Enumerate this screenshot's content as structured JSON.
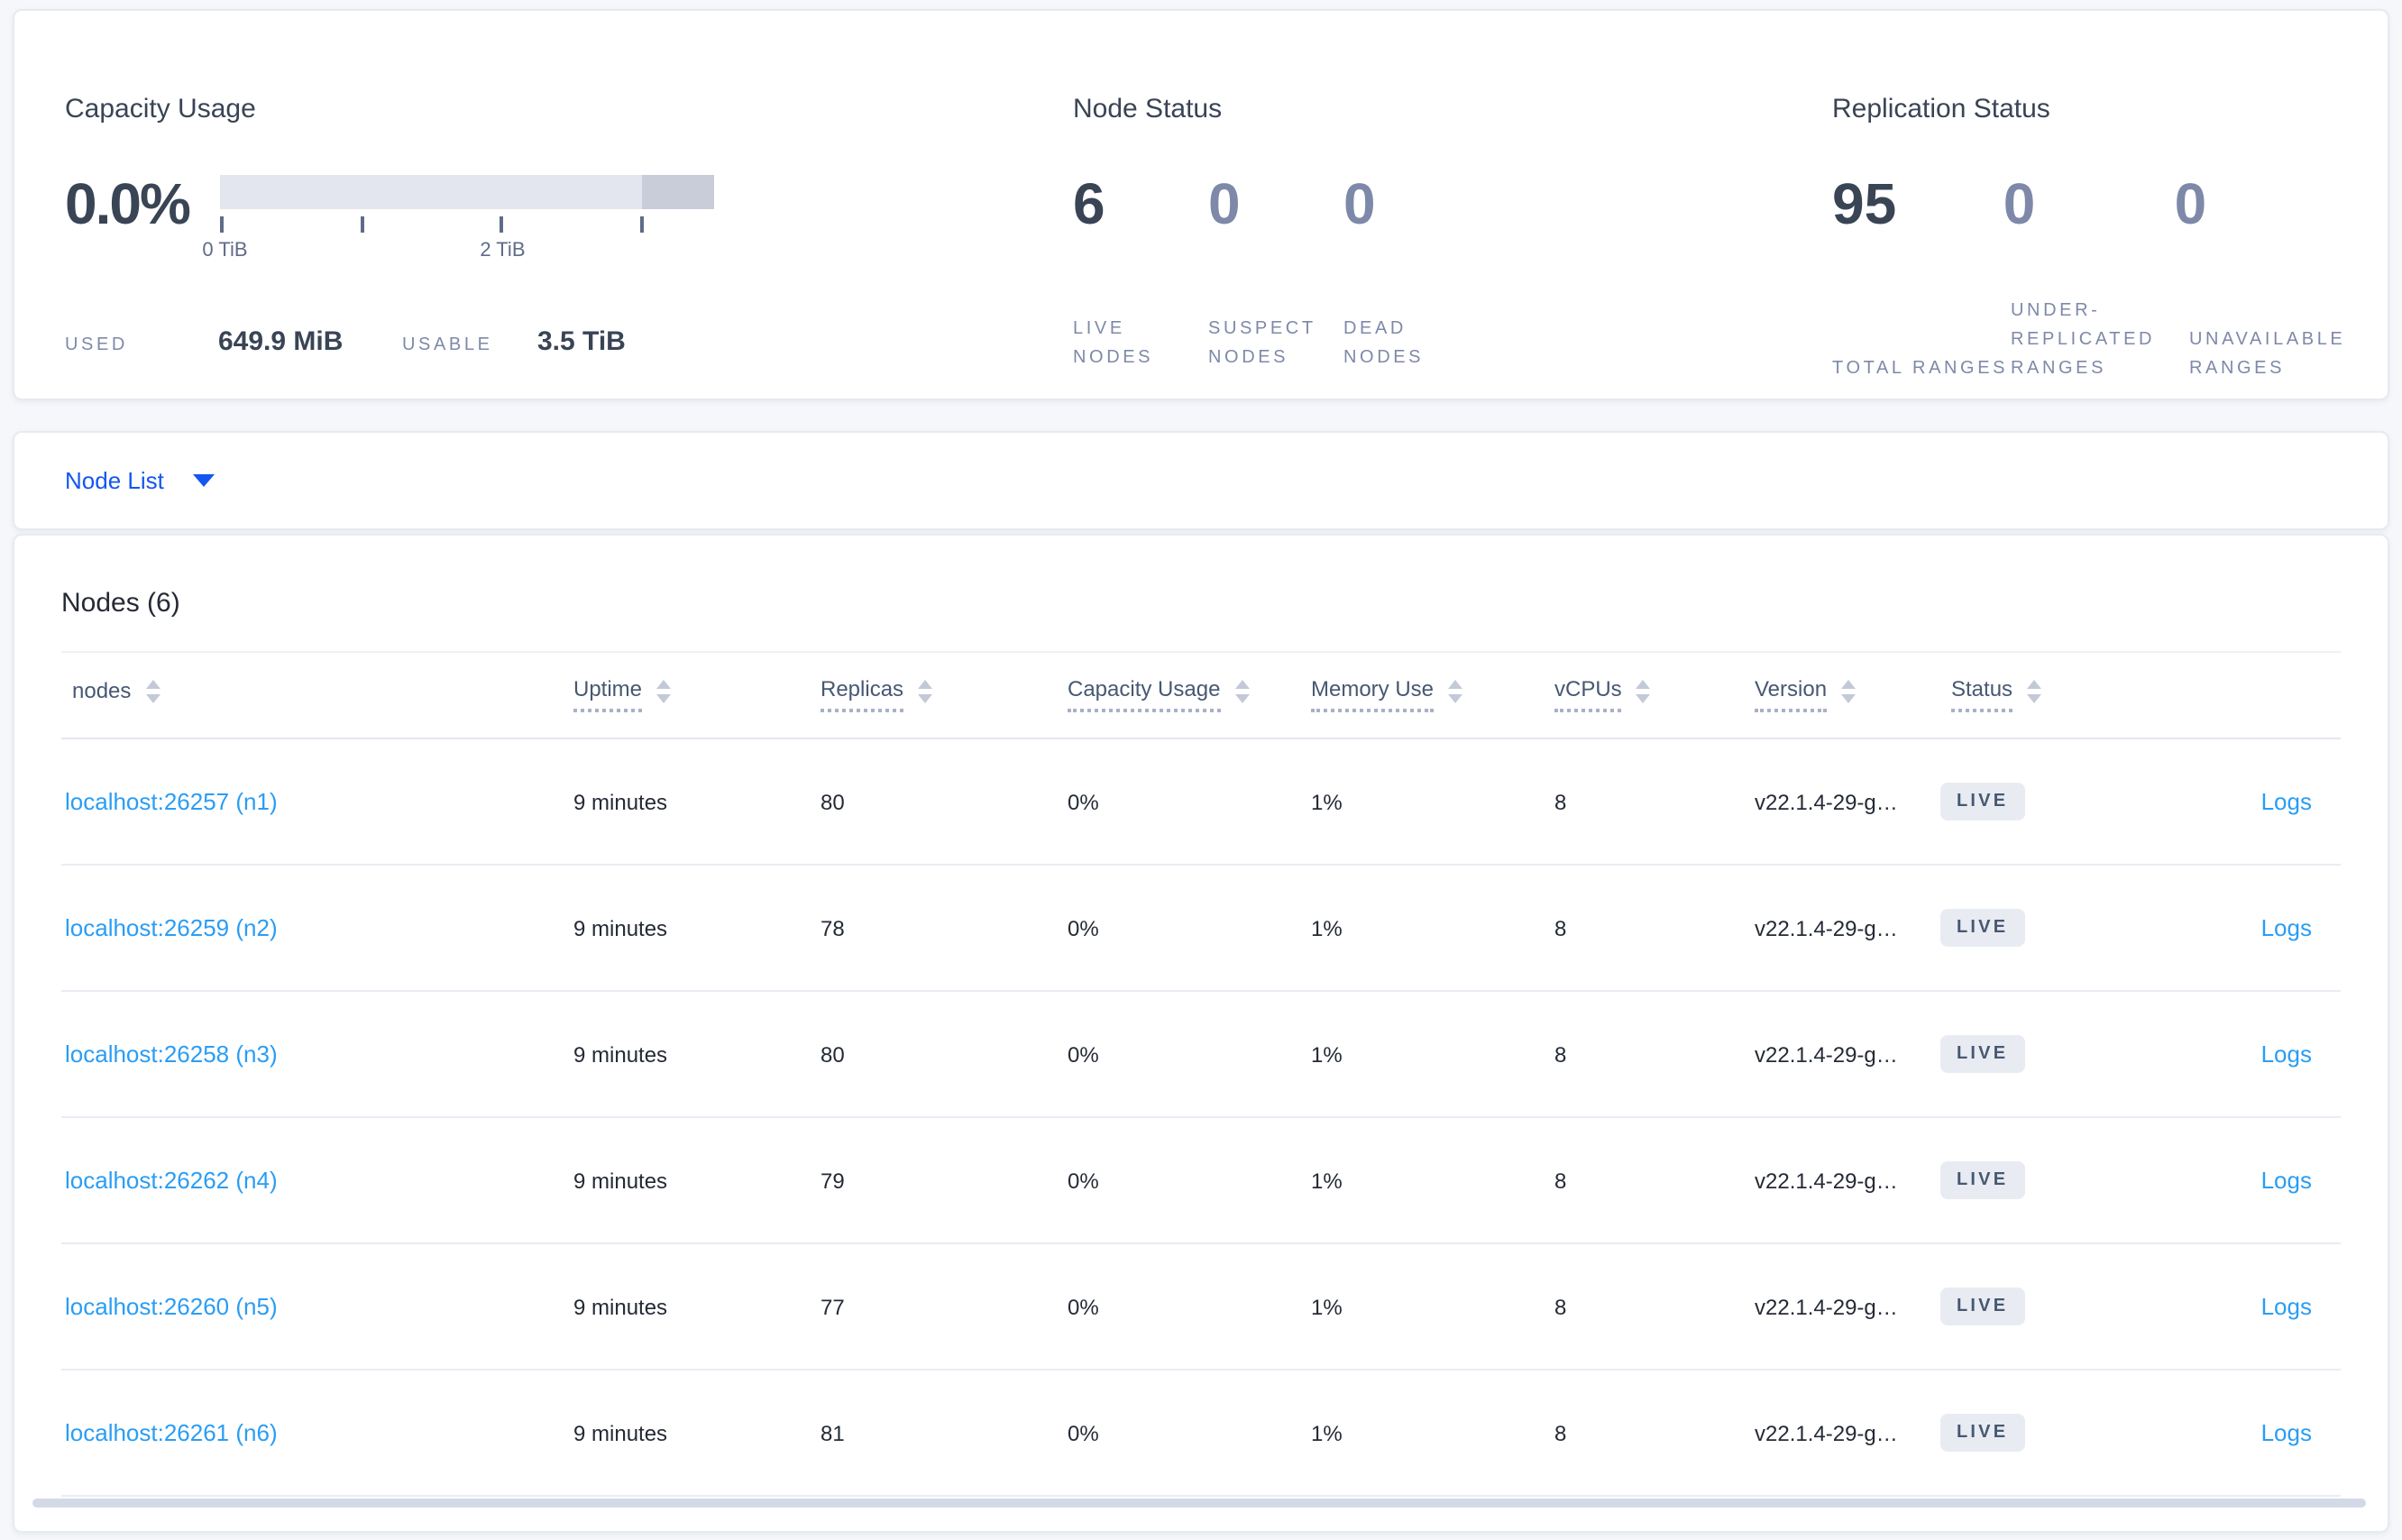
{
  "summary": {
    "capacity": {
      "title": "Capacity Usage",
      "percent": "0.0%",
      "tick_labels": [
        "0 TiB",
        "2 TiB"
      ],
      "stats": [
        {
          "label": "USED",
          "value": "649.9 MiB"
        },
        {
          "label": "USABLE",
          "value": "3.5 TiB"
        }
      ]
    },
    "node_status": {
      "title": "Node Status",
      "stats": [
        {
          "value": "6",
          "label": "LIVE NODES"
        },
        {
          "value": "0",
          "label": "SUSPECT NODES"
        },
        {
          "value": "0",
          "label": "DEAD NODES"
        }
      ]
    },
    "replication": {
      "title": "Replication Status",
      "stats": [
        {
          "value": "95",
          "label": "TOTAL RANGES"
        },
        {
          "value": "0",
          "label": "UNDER-REPLICATED RANGES"
        },
        {
          "value": "0",
          "label": "UNAVAILABLE RANGES"
        }
      ]
    }
  },
  "view_selector": {
    "label": "Node List"
  },
  "nodes_table": {
    "title": "Nodes (6)",
    "columns": [
      "nodes",
      "Uptime",
      "Replicas",
      "Capacity Usage",
      "Memory Use",
      "vCPUs",
      "Version",
      "Status"
    ],
    "logs_label": "Logs",
    "rows": [
      {
        "address": "localhost:26257 (n1)",
        "uptime": "9 minutes",
        "replicas": "80",
        "capacity_usage": "0%",
        "memory_use": "1%",
        "vcpus": "8",
        "version": "v22.1.4-29-g…",
        "status": "LIVE",
        "logs": "Logs"
      },
      {
        "address": "localhost:26259 (n2)",
        "uptime": "9 minutes",
        "replicas": "78",
        "capacity_usage": "0%",
        "memory_use": "1%",
        "vcpus": "8",
        "version": "v22.1.4-29-g…",
        "status": "LIVE",
        "logs": "Logs"
      },
      {
        "address": "localhost:26258 (n3)",
        "uptime": "9 minutes",
        "replicas": "80",
        "capacity_usage": "0%",
        "memory_use": "1%",
        "vcpus": "8",
        "version": "v22.1.4-29-g…",
        "status": "LIVE",
        "logs": "Logs"
      },
      {
        "address": "localhost:26262 (n4)",
        "uptime": "9 minutes",
        "replicas": "79",
        "capacity_usage": "0%",
        "memory_use": "1%",
        "vcpus": "8",
        "version": "v22.1.4-29-g…",
        "status": "LIVE",
        "logs": "Logs"
      },
      {
        "address": "localhost:26260 (n5)",
        "uptime": "9 minutes",
        "replicas": "77",
        "capacity_usage": "0%",
        "memory_use": "1%",
        "vcpus": "8",
        "version": "v22.1.4-29-g…",
        "status": "LIVE",
        "logs": "Logs"
      },
      {
        "address": "localhost:26261 (n6)",
        "uptime": "9 minutes",
        "replicas": "81",
        "capacity_usage": "0%",
        "memory_use": "1%",
        "vcpus": "8",
        "version": "v22.1.4-29-g…",
        "status": "LIVE",
        "logs": "Logs"
      }
    ]
  },
  "colors": {
    "accent_blue": "#1456f0",
    "link_blue": "#2a9df4",
    "bar_track": "#e3e6ee",
    "bar_secondary": "#c9cdd9",
    "badge_bg": "#e8ecf2",
    "text_dark": "#394455",
    "text_muted": "#7e89a9"
  }
}
